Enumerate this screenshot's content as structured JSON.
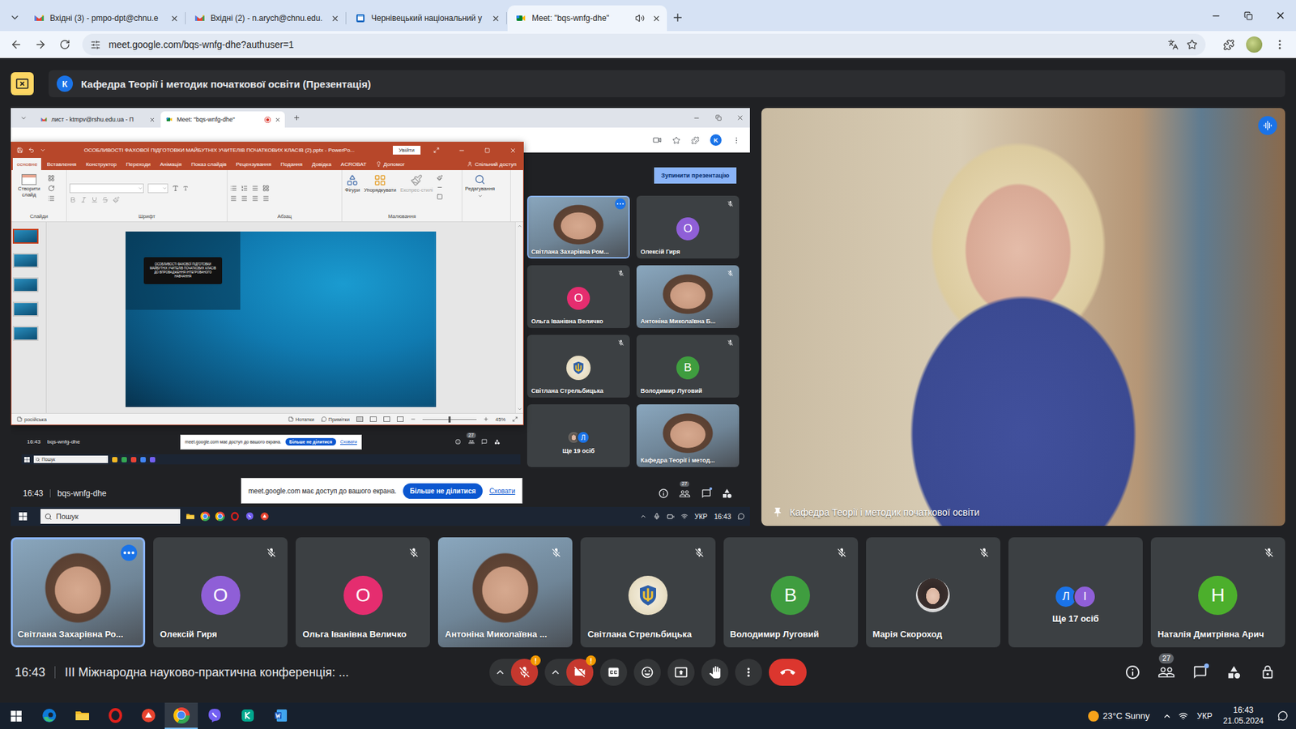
{
  "browser": {
    "tabs": [
      {
        "title": "Вхідні (3) - pmpo-dpt@chnu.e",
        "kind": "gmail",
        "selected": false,
        "audio": false
      },
      {
        "title": "Вхідні (2) - n.arych@chnu.edu.",
        "kind": "gmail",
        "selected": false,
        "audio": false
      },
      {
        "title": "Чернівецький національний у",
        "kind": "site",
        "selected": false,
        "audio": false
      },
      {
        "title": "Meet: \"bqs-wnfg-dhe\"",
        "kind": "meet",
        "selected": true,
        "audio": true
      }
    ],
    "url": "meet.google.com/bqs-wnfg-dhe?authuser=1"
  },
  "meet": {
    "banner": {
      "avatar": "К",
      "title": "Кафедра Теорії і методик початкової освіти (Презентація)"
    },
    "shared_screen": {
      "tabs": [
        {
          "title": "лист - ktmpv@rshu.edu.ua - П",
          "kind": "gmail",
          "selected": false,
          "recording": false
        },
        {
          "title": "Meet: \"bqs-wnfg-dhe\"",
          "kind": "meet",
          "selected": true,
          "recording": true
        }
      ],
      "profile": "K",
      "stop_button": "Зупинити презентацію",
      "tiles": [
        {
          "name": "Світлана Захарівна Ром...",
          "kind": "video",
          "muted": false,
          "speaking": true
        },
        {
          "name": "Олексій Гиря",
          "kind": "avatar",
          "letter": "О",
          "color": "#8f5fd7",
          "muted": true,
          "speaking": false
        },
        {
          "name": "Ольга Іванівна Величко",
          "kind": "avatar",
          "letter": "О",
          "color": "#e52d6f",
          "muted": true,
          "speaking": false
        },
        {
          "name": "Антоніна Миколаївна Б...",
          "kind": "video",
          "muted": true,
          "speaking": false
        },
        {
          "name": "Світлана Стрельбицька",
          "kind": "emblem",
          "muted": true,
          "speaking": false
        },
        {
          "name": "Володимир Луговий",
          "kind": "avatar",
          "letter": "В",
          "color": "#3f9d3f",
          "muted": true,
          "speaking": false
        },
        {
          "name": "Ще 19 осіб",
          "kind": "group",
          "letters": [
            {
              "kind": "photo",
              "letter": "",
              "color": "#6d6a66"
            },
            {
              "kind": "letter",
              "letter": "Л",
              "color": "#1a73e8"
            }
          ],
          "muted": false,
          "speaking": false
        },
        {
          "name": "Кафедра Теорії і метод...",
          "kind": "video",
          "muted": false,
          "speaking": false
        }
      ],
      "bar": {
        "time": "16:43",
        "code": "bqs-wnfg-dhe",
        "people_count": "27",
        "chat_unread": true
      },
      "share_notice": {
        "text": "meet.google.com має доступ до вашого екрана.",
        "stop": "Більше не ділитися",
        "hide": "Сховати"
      },
      "taskbar": {
        "search": "Пошук",
        "language": "УКР",
        "time": "16:43"
      },
      "nested": {
        "time": "16:43",
        "code": "bqs-wnfg-dhe",
        "people_count": "27",
        "share_notice": {
          "text": "meet.google.com має доступ до вашого екрана.",
          "stop": "Більше не ділитися",
          "hide": "Сховати"
        },
        "search": "Пошук"
      },
      "powerpoint": {
        "title": "ОСОБЛИВОСТІ ФАХОВОЇ ПІДГОТОВКИ МАЙБУТНІХ УЧИТЕЛІВ ПОЧАТКОВИХ КЛАСІВ (2).pptx - PowerPo...",
        "signin": "Увійти",
        "tabs": [
          {
            "label": "основне",
            "selected": true
          },
          {
            "label": "Вставлення",
            "selected": false
          },
          {
            "label": "Конструктор",
            "selected": false
          },
          {
            "label": "Переходи",
            "selected": false
          },
          {
            "label": "Анімація",
            "selected": false
          },
          {
            "label": "Показ слайдів",
            "selected": false
          },
          {
            "label": "Рецензування",
            "selected": false
          },
          {
            "label": "Подання",
            "selected": false
          },
          {
            "label": "Довідка",
            "selected": false
          },
          {
            "label": "ACROBAT",
            "selected": false
          },
          {
            "label": "Допомог",
            "selected": false
          }
        ],
        "share": "Спільний доступ",
        "ribbon": {
          "new_slide": "Створити слайд",
          "slides": "Слайди",
          "font": "Шрифт",
          "paragraph": "Абзац",
          "shapes": "Фігури",
          "arrange": "Упорядкувати",
          "quick_styles": "Експрес-стилі",
          "quick_styles_disabled": true,
          "drawing": "Малювання",
          "editing": "Редагування"
        },
        "thumbnails": [
          {
            "selected": true
          },
          {
            "selected": false
          },
          {
            "selected": false
          },
          {
            "selected": false
          },
          {
            "selected": false
          }
        ],
        "slide": {
          "title": "ОСОБЛИВОСТІ ФАХОВОЇ ПІДГОТОВКИ МАЙБУТНІХ УЧИТЕЛІВ ПОЧАТКОВИХ КЛАСІВ ДО ВПРОВАДЖЕННЯ ІНТЕГРОВАНОГО НАВЧАННЯ"
        },
        "status": {
          "language": "російська",
          "notes": "Нотатки",
          "comments": "Примітки",
          "zoom": "45%",
          "zoom_level": 0.5
        }
      }
    },
    "speaker": {
      "name": "Кафедра Теорії і методик початкової освіти",
      "pinned": true,
      "speaking": true
    },
    "tiles": [
      {
        "name": "Світлана Захарівна Ро...",
        "kind": "video",
        "muted": false,
        "speaking": true
      },
      {
        "name": "Олексій Гиря",
        "kind": "avatar",
        "letter": "О",
        "color": "#8f5fd7",
        "muted": true,
        "speaking": false
      },
      {
        "name": "Ольга Іванівна Величко",
        "kind": "avatar",
        "letter": "О",
        "color": "#e52d6f",
        "muted": true,
        "speaking": false
      },
      {
        "name": "Антоніна Миколаївна ...",
        "kind": "video",
        "muted": true,
        "speaking": false
      },
      {
        "name": "Світлана Стрельбицька",
        "kind": "emblem",
        "muted": true,
        "speaking": false
      },
      {
        "name": "Володимир Луговий",
        "kind": "avatar",
        "letter": "В",
        "color": "#3f9d3f",
        "muted": true,
        "speaking": false
      },
      {
        "name": "Марія Скороход",
        "kind": "photo",
        "muted": true,
        "speaking": false
      },
      {
        "name": "Ще 17 осіб",
        "kind": "group",
        "letters": [
          {
            "kind": "letter",
            "letter": "Л",
            "color": "#1a73e8"
          },
          {
            "kind": "letter",
            "letter": "І",
            "color": "#8f5fd7"
          }
        ],
        "muted": false,
        "speaking": false
      },
      {
        "name": "Наталія Дмитрівна Арич",
        "kind": "avatar",
        "letter": "Н",
        "color": "#4caf2c",
        "muted": true,
        "speaking": false
      }
    ],
    "bottom_bar": {
      "time": "16:43",
      "title": "III Міжнародна науково-практична конференція: ...",
      "mic": {
        "on": false,
        "alert": "!"
      },
      "camera": {
        "on": false,
        "alert": "!"
      },
      "people_count": "27",
      "chat_unread": true
    }
  },
  "taskbar": {
    "weather": "23°C Sunny",
    "language": "УКР",
    "time": "16:43",
    "date": "21.05.2024",
    "apps": [
      {
        "kind": "edge",
        "selected": false
      },
      {
        "kind": "explorer",
        "selected": false
      },
      {
        "kind": "opera",
        "selected": false
      },
      {
        "kind": "redapp",
        "selected": false
      },
      {
        "kind": "chrome",
        "selected": true
      },
      {
        "kind": "viber",
        "selected": false
      },
      {
        "kind": "kaspersky",
        "selected": false
      },
      {
        "kind": "word",
        "selected": false
      }
    ]
  }
}
